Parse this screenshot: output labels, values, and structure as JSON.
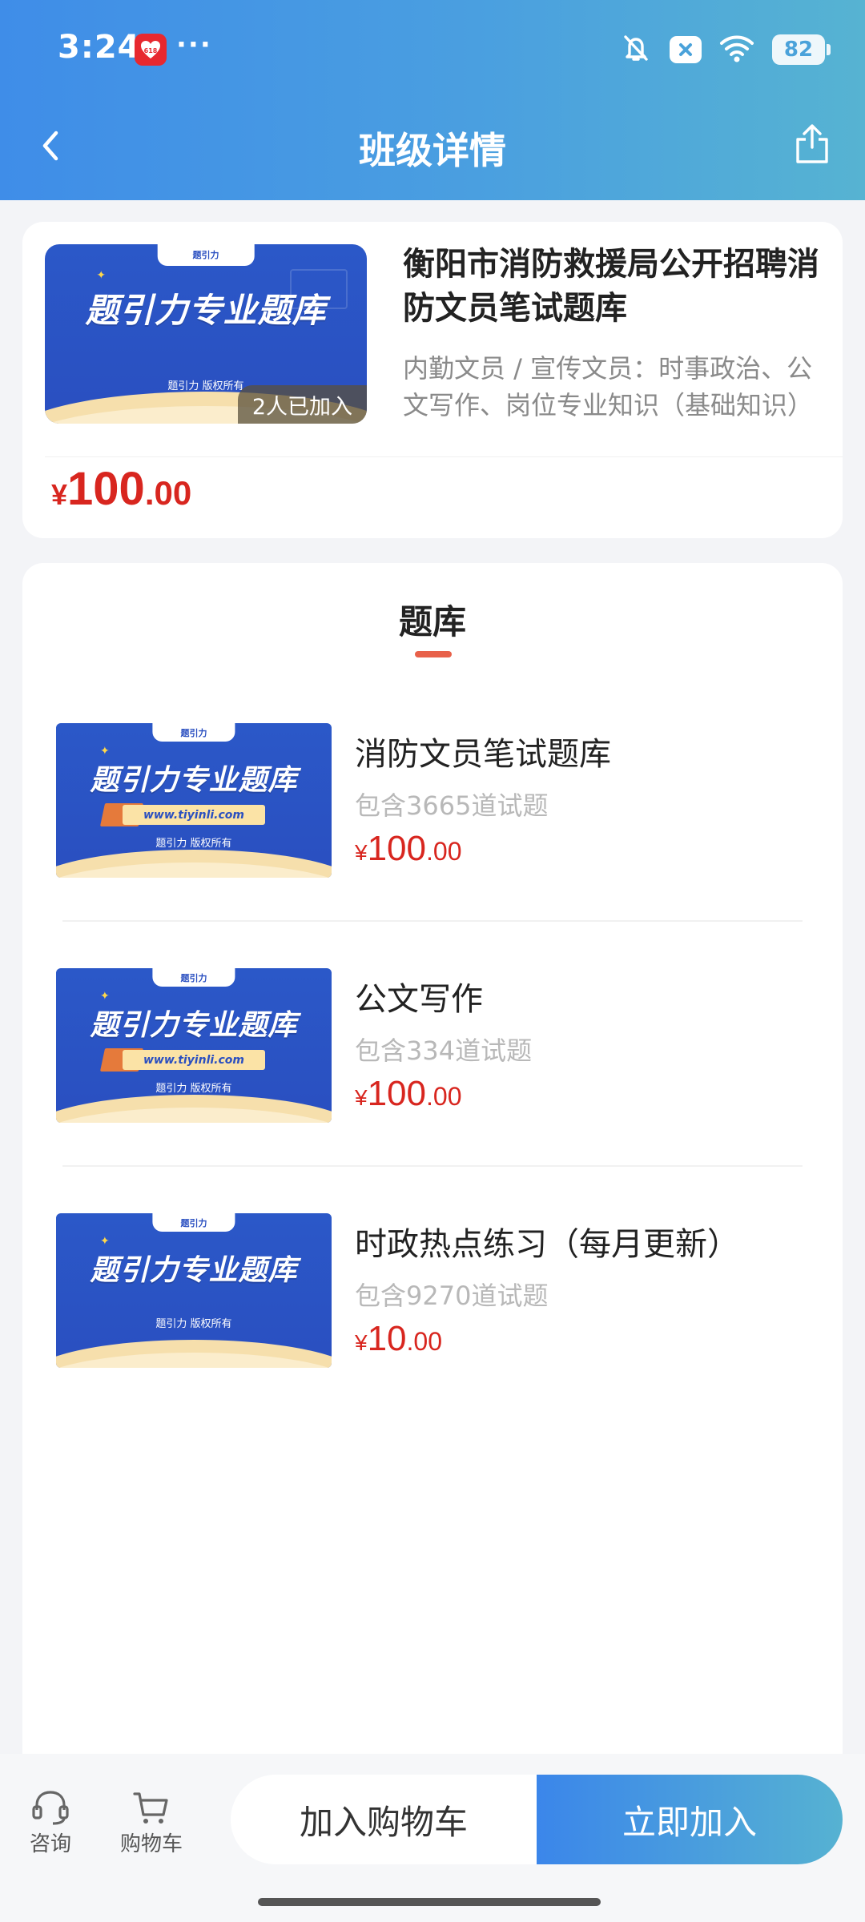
{
  "status_bar": {
    "time": "3:24",
    "app_badge_text": "618",
    "more": "···",
    "battery": "82"
  },
  "nav": {
    "title": "班级详情"
  },
  "course": {
    "title": "衡阳市消防救援局公开招聘消防文员笔试题库",
    "description": "内勤文员 / 宣传文员：时事政治、公文写作、岗位专业知识（基础知识）",
    "joined": "2人已加入",
    "price_currency": "¥",
    "price_int": "100",
    "price_dec": ".00",
    "thumb": {
      "tab": "题引力",
      "headline": "题引力专业题库",
      "copyright": "题引力 版权所有"
    }
  },
  "section": {
    "title": "题库"
  },
  "banks": [
    {
      "name": "消防文员笔试题库",
      "count": "包含3665道试题",
      "price_currency": "¥",
      "price_int": "100",
      "price_dec": ".00",
      "thumb": {
        "tab": "题引力",
        "headline": "题引力专业题库",
        "url": "www.tiyinli.com",
        "copyright": "题引力 版权所有"
      }
    },
    {
      "name": "公文写作",
      "count": "包含334道试题",
      "price_currency": "¥",
      "price_int": "100",
      "price_dec": ".00",
      "thumb": {
        "tab": "题引力",
        "headline": "题引力专业题库",
        "url": "www.tiyinli.com",
        "copyright": "题引力 版权所有"
      }
    },
    {
      "name": "时政热点练习（每月更新）",
      "count": "包含9270道试题",
      "price_currency": "¥",
      "price_int": "10",
      "price_dec": ".00",
      "thumb": {
        "tab": "题引力",
        "headline": "题引力专业题库",
        "copyright": "题引力 版权所有"
      }
    }
  ],
  "bottom_bar": {
    "consult_label": "咨询",
    "cart_label": "购物车",
    "add_to_cart": "加入购物车",
    "join_now": "立即加入"
  },
  "colors": {
    "header_start": "#3f8de8",
    "header_end": "#56b3d2",
    "price_red": "#d8261f",
    "accent_underline": "#e8614a",
    "thumb_blue": "#2a4fc0"
  }
}
